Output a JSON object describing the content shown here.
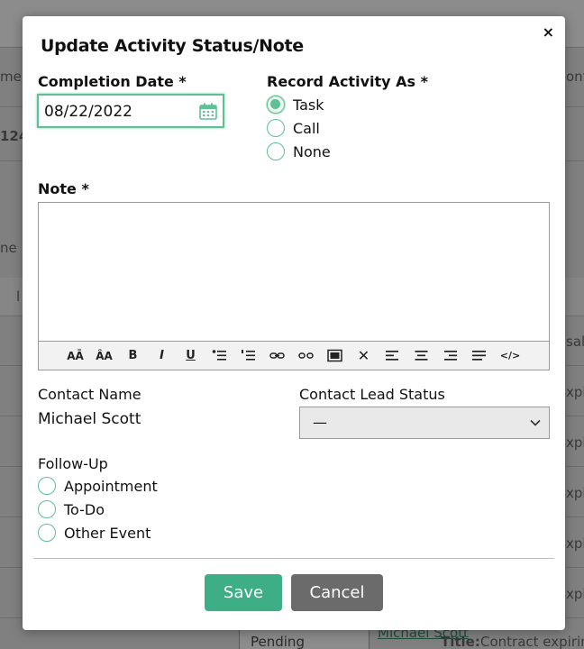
{
  "background": {
    "fragments": [
      "me",
      "ont",
      "1244",
      "ne",
      "l",
      "sal",
      "xpirin",
      "xpirin",
      "xpirin",
      "xpirin",
      "xpirin"
    ],
    "bottom_row": {
      "status": "Pending",
      "link": "Michael Scott",
      "title_label": "Title:",
      "title_value": "Contract expiring"
    }
  },
  "modal": {
    "title": "Update Activity Status/Note",
    "close_symbol": "×",
    "completion_date_label": "Completion Date *",
    "completion_date_value": "08/22/2022",
    "record_activity_label": "Record Activity As *",
    "record_options": [
      {
        "label": "Task",
        "checked": true
      },
      {
        "label": "Call",
        "checked": false
      },
      {
        "label": "None",
        "checked": false
      }
    ],
    "note_label": "Note *",
    "note_value": "",
    "toolbar": [
      {
        "name": "font-size-icon",
        "glyph": "AĀ"
      },
      {
        "name": "font-case-icon",
        "glyph": "ÂA"
      },
      {
        "name": "bold-icon",
        "glyph": "B"
      },
      {
        "name": "italic-icon",
        "glyph": "I"
      },
      {
        "name": "underline-icon",
        "glyph": "U"
      },
      {
        "name": "bulleted-list-icon",
        "glyph": ""
      },
      {
        "name": "numbered-list-icon",
        "glyph": ""
      },
      {
        "name": "link-icon",
        "glyph": ""
      },
      {
        "name": "unlink-icon",
        "glyph": ""
      },
      {
        "name": "image-icon",
        "glyph": ""
      },
      {
        "name": "clear-format-icon",
        "glyph": "✕"
      },
      {
        "name": "align-left-icon",
        "glyph": ""
      },
      {
        "name": "align-center-icon",
        "glyph": ""
      },
      {
        "name": "align-right-icon",
        "glyph": ""
      },
      {
        "name": "align-justify-icon",
        "glyph": ""
      },
      {
        "name": "code-view-icon",
        "glyph": "</>"
      }
    ],
    "contact_name_label": "Contact Name",
    "contact_name_value": "Michael Scott",
    "lead_status_label": "Contact Lead Status",
    "lead_status_value": "—",
    "follow_up_label": "Follow-Up",
    "follow_up_options": [
      {
        "label": "Appointment",
        "checked": false
      },
      {
        "label": "To-Do",
        "checked": false
      },
      {
        "label": "Other Event",
        "checked": false
      }
    ],
    "save_label": "Save",
    "cancel_label": "Cancel"
  },
  "colors": {
    "accent": "#5fbf95",
    "save_button": "#3dae85",
    "cancel_button": "#6b6b6b",
    "overlay": "#808080"
  }
}
